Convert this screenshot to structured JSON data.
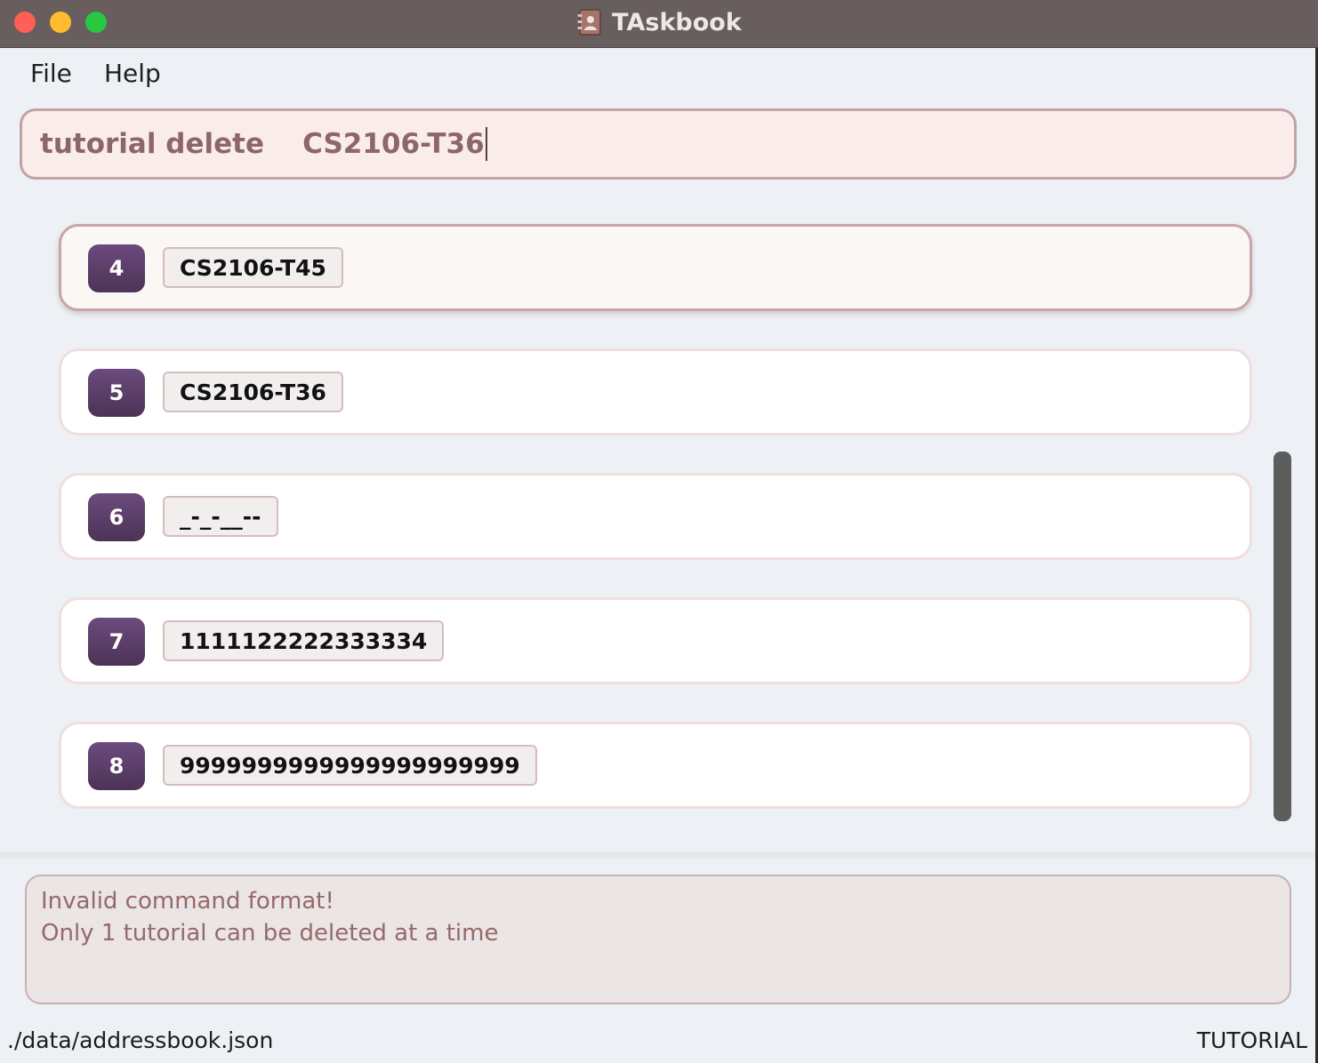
{
  "window": {
    "title": "TAskbook"
  },
  "menu": {
    "items": [
      {
        "label": "File"
      },
      {
        "label": "Help"
      }
    ]
  },
  "command": {
    "value": "tutorial delete    CS2106-T36"
  },
  "tutorials": [
    {
      "index": "4",
      "code": "CS2106-T45",
      "selected": true
    },
    {
      "index": "5",
      "code": "CS2106-T36",
      "selected": false
    },
    {
      "index": "6",
      "code": "_-_-__--",
      "selected": false
    },
    {
      "index": "7",
      "code": "1111122222333334",
      "selected": false
    },
    {
      "index": "8",
      "code": "9999999999999999999999",
      "selected": false
    }
  ],
  "result": {
    "lines": [
      "Invalid command format!",
      "Only 1 tutorial can be deleted at a time"
    ]
  },
  "status": {
    "file_path": "./data/addressbook.json",
    "mode": "TUTORIAL"
  },
  "colors": {
    "titlebar": "#675e5d",
    "badge": "#5a3d68",
    "command_text": "#8d6668",
    "result_text": "#96696a"
  }
}
